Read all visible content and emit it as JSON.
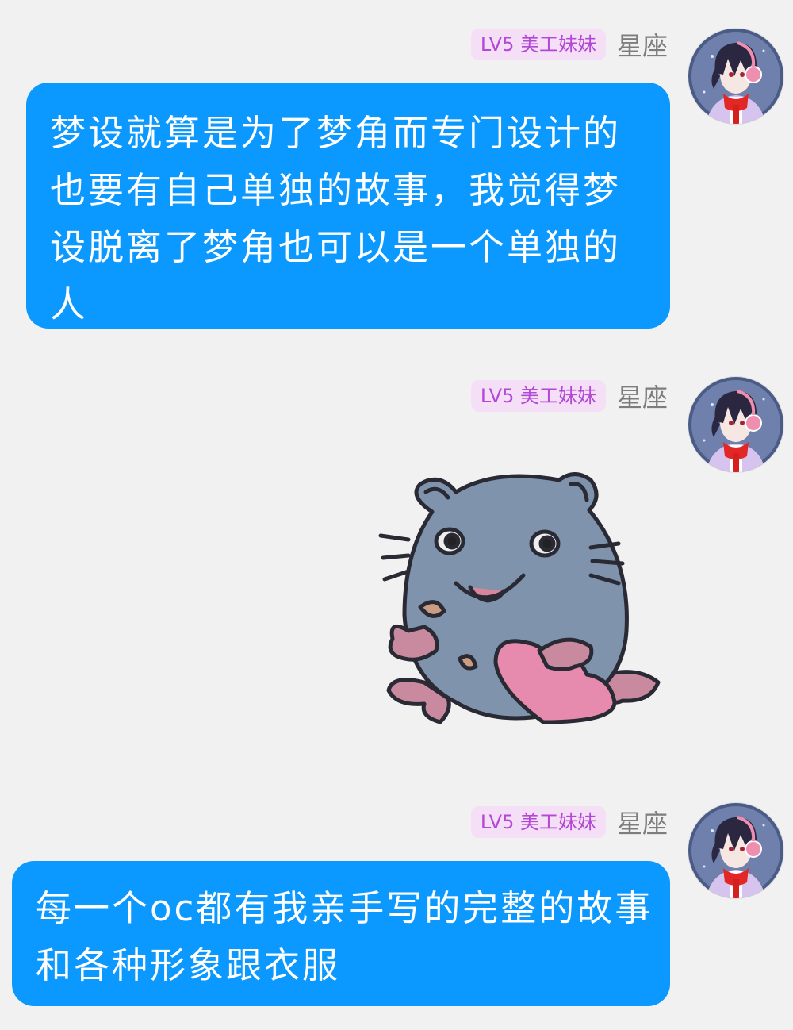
{
  "messages": [
    {
      "badge": "LV5 美工妹妹",
      "sender": "星座",
      "type": "text",
      "text": "梦设就算是为了梦角而专门设计的也要有自己单独的故事，我觉得梦设脱离了梦角也可以是一个单独的人"
    },
    {
      "badge": "LV5 美工妹妹",
      "sender": "星座",
      "type": "sticker",
      "sticker": "blue-seal-holding-heart-sticker"
    },
    {
      "badge": "LV5 美工妹妹",
      "sender": "星座",
      "type": "text",
      "text": "每一个oc都有我亲手写的完整的故事和各种形象跟衣服"
    }
  ],
  "colors": {
    "background": "#f1f1f1",
    "bubble": "#0b98ff",
    "badge_bg": "#f4dff7",
    "badge_text": "#b347d6",
    "sender_text": "#7d7d7d"
  }
}
